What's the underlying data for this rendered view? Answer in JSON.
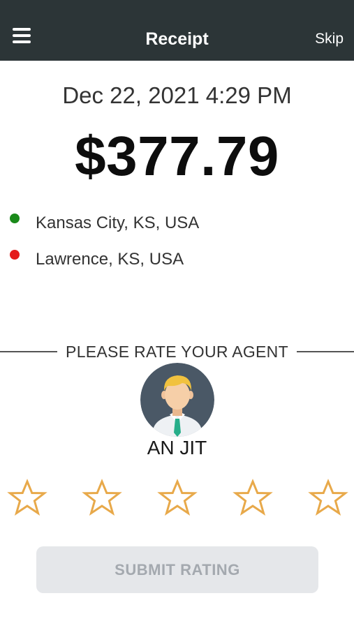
{
  "header": {
    "title": "Receipt",
    "skip_label": "Skip",
    "background_color": "#2c3537"
  },
  "receipt": {
    "datetime": "Dec 22, 2021 4:29 PM",
    "amount": "$377.79"
  },
  "locations": [
    {
      "label": "Kansas City, KS, USA",
      "dot_color": "#1a8a1a",
      "role": "pickup"
    },
    {
      "label": "Lawrence, KS, USA",
      "dot_color": "#e41b1b",
      "role": "dropoff"
    }
  ],
  "rating": {
    "prompt": "PLEASE RATE YOUR AGENT",
    "agent_name": "AN JIT",
    "max_stars": 5,
    "selected_stars": 0,
    "star_color": "#e8a94a",
    "submit_label": "SUBMIT RATING"
  },
  "icons": [
    "hamburger-menu-icon",
    "agent-avatar-icon",
    "star-outline-icon"
  ]
}
